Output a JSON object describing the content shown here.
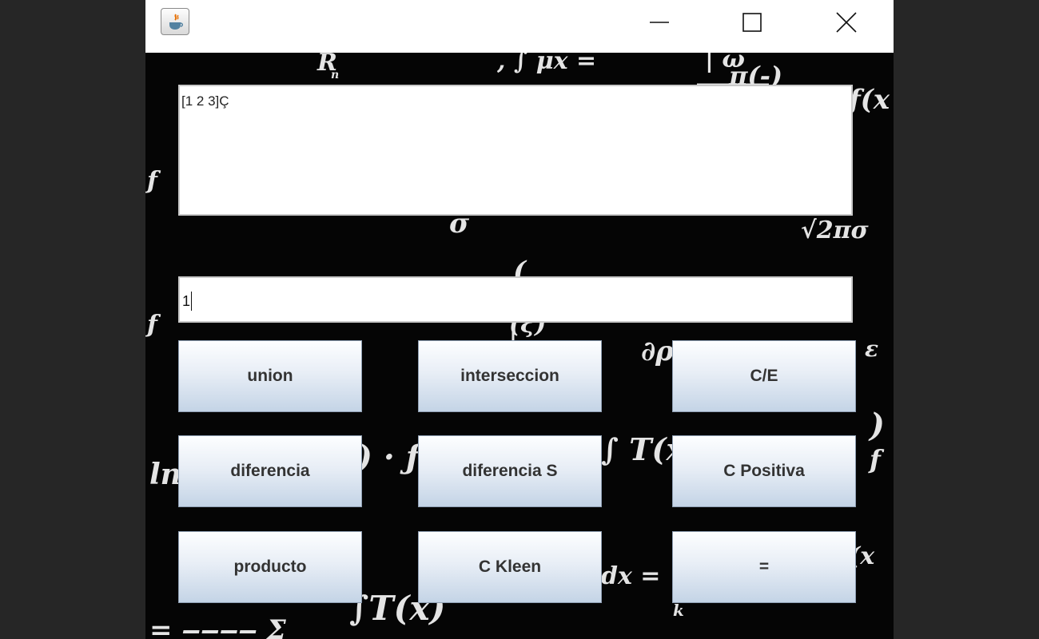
{
  "window": {
    "icon": "java-cup-icon",
    "controls": {
      "minimize": "minimize-icon",
      "maximize": "maximize-icon",
      "close": "close-icon"
    }
  },
  "output_area": {
    "text": "[1 2 3]Ç"
  },
  "input_field": {
    "value": "1"
  },
  "buttons": [
    {
      "label": "union"
    },
    {
      "label": "interseccion"
    },
    {
      "label": "C/E"
    },
    {
      "label": "diferencia"
    },
    {
      "label": "diferencia S"
    },
    {
      "label": "C Positiva"
    },
    {
      "label": "producto"
    },
    {
      "label": "C Kleen"
    },
    {
      "label": "="
    }
  ],
  "background": {
    "image": "math-formulas-background"
  }
}
